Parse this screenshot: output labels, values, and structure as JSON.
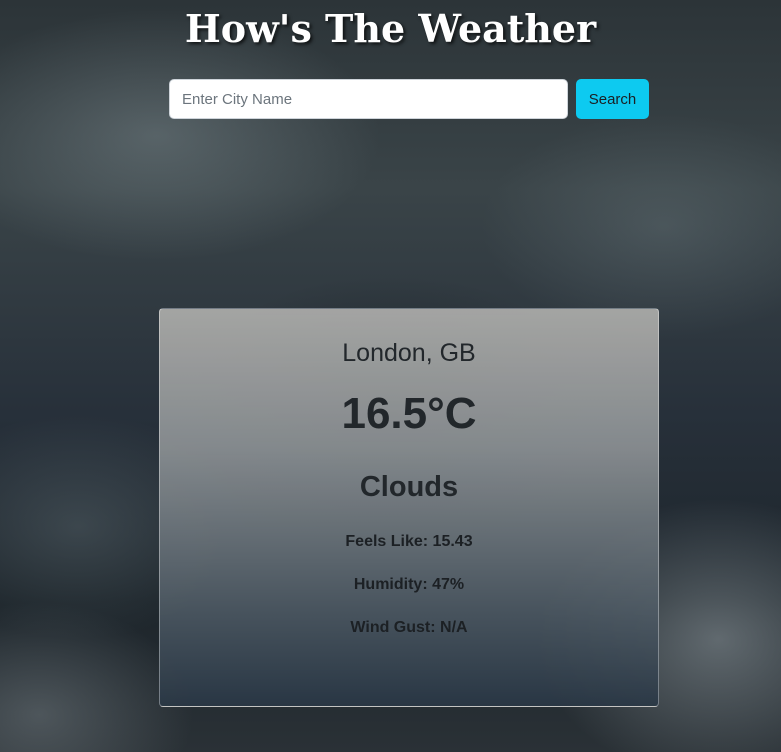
{
  "header": {
    "title": "How's The Weather"
  },
  "search": {
    "placeholder": "Enter City Name",
    "value": "",
    "button_label": "Search"
  },
  "weather": {
    "location": "London, GB",
    "temperature": "16.5°C",
    "condition": "Clouds",
    "feels_like": "Feels Like: 15.43",
    "humidity": "Humidity: 47%",
    "wind_gust": "Wind Gust: N/A"
  },
  "colors": {
    "search_button": "#0dcaf0",
    "title_text": "#ffffff"
  }
}
